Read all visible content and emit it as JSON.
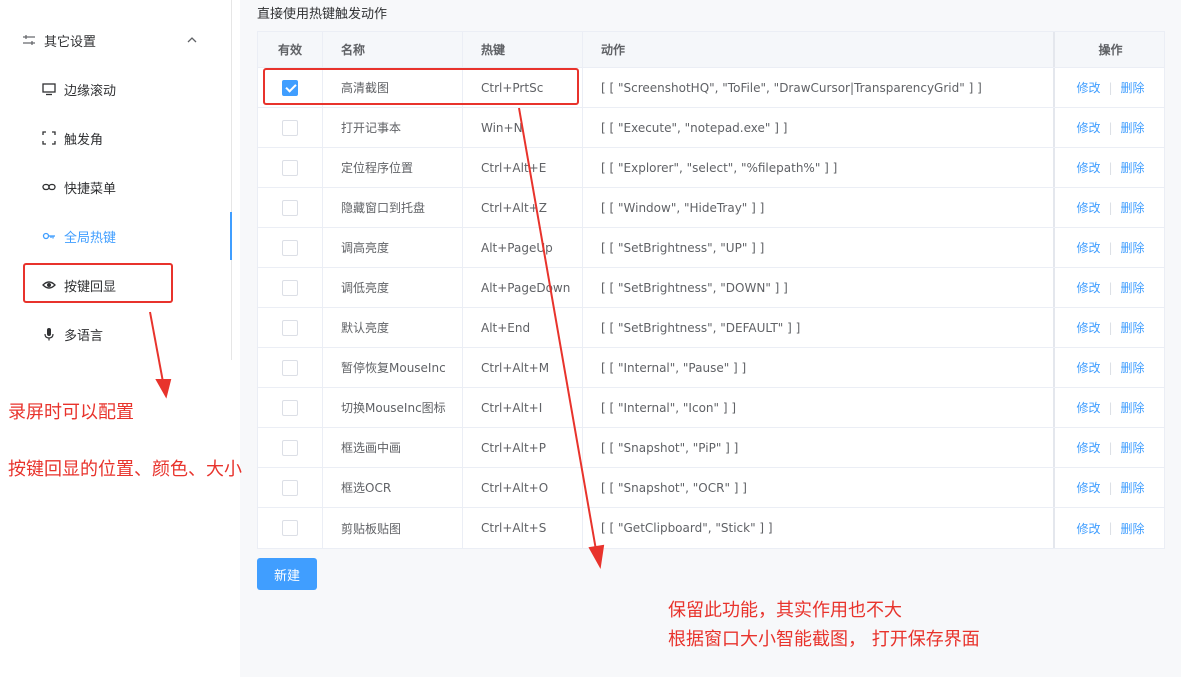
{
  "sidebar": {
    "submenu_title": "其它设置",
    "items": [
      {
        "label": "边缘滚动",
        "icon": "monitor-icon"
      },
      {
        "label": "触发角",
        "icon": "corners-icon"
      },
      {
        "label": "快捷菜单",
        "icon": "link-icon"
      },
      {
        "label": "全局热键",
        "icon": "key-icon"
      },
      {
        "label": "按键回显",
        "icon": "eye-icon"
      },
      {
        "label": "多语言",
        "icon": "microphone-icon"
      }
    ],
    "active_item": "全局热键"
  },
  "main": {
    "section_title": "直接使用热键触发动作",
    "table": {
      "headers": {
        "enable": "有效",
        "name": "名称",
        "hotkey": "热键",
        "action": "动作",
        "ops": "操作"
      },
      "rows": [
        {
          "checked": true,
          "name": "高清截图",
          "hotkey": "Ctrl+PrtSc",
          "action": "[ [ \"ScreenshotHQ\", \"ToFile\", \"DrawCursor|TransparencyGrid\" ] ]"
        },
        {
          "checked": false,
          "name": "打开记事本",
          "hotkey": "Win+N",
          "action": "[ [ \"Execute\", \"notepad.exe\" ] ]"
        },
        {
          "checked": false,
          "name": "定位程序位置",
          "hotkey": "Ctrl+Alt+E",
          "action": "[ [ \"Explorer\", \"select\", \"%filepath%\" ] ]"
        },
        {
          "checked": false,
          "name": "隐藏窗口到托盘",
          "hotkey": "Ctrl+Alt+Z",
          "action": "[ [ \"Window\", \"HideTray\" ] ]"
        },
        {
          "checked": false,
          "name": "调高亮度",
          "hotkey": "Alt+PageUp",
          "action": "[ [ \"SetBrightness\", \"UP\" ] ]"
        },
        {
          "checked": false,
          "name": "调低亮度",
          "hotkey": "Alt+PageDown",
          "action": "[ [ \"SetBrightness\", \"DOWN\" ] ]"
        },
        {
          "checked": false,
          "name": "默认亮度",
          "hotkey": "Alt+End",
          "action": "[ [ \"SetBrightness\", \"DEFAULT\" ] ]"
        },
        {
          "checked": false,
          "name": "暂停恢复MouseInc",
          "hotkey": "Ctrl+Alt+M",
          "action": "[ [ \"Internal\", \"Pause\" ] ]"
        },
        {
          "checked": false,
          "name": "切换MouseInc图标",
          "hotkey": "Ctrl+Alt+I",
          "action": "[ [ \"Internal\", \"Icon\" ] ]"
        },
        {
          "checked": false,
          "name": "框选画中画",
          "hotkey": "Ctrl+Alt+P",
          "action": "[ [ \"Snapshot\", \"PiP\" ] ]"
        },
        {
          "checked": false,
          "name": "框选OCR",
          "hotkey": "Ctrl+Alt+O",
          "action": "[ [ \"Snapshot\", \"OCR\" ] ]"
        },
        {
          "checked": false,
          "name": "剪贴板贴图",
          "hotkey": "Ctrl+Alt+S",
          "action": "[ [ \"GetClipboard\", \"Stick\" ] ]"
        }
      ],
      "edit_label": "修改",
      "delete_label": "删除"
    },
    "new_button": "新建"
  },
  "annotations": {
    "left_line1": "录屏时可以配置",
    "left_line2": "按键回显的位置、颜色、大小",
    "right_line1": "保留此功能，其实作用也不大",
    "right_line2": "根据窗口大小智能截图，  打开保存界面"
  },
  "colors": {
    "accent": "#409eff",
    "annotation": "#e8332c"
  }
}
